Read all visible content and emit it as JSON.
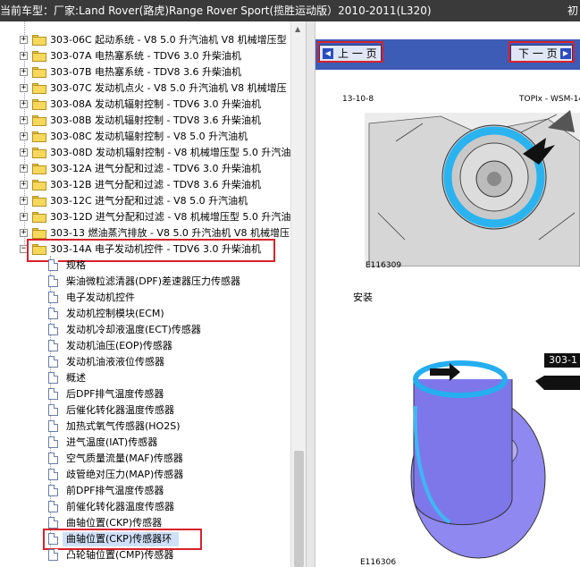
{
  "window": {
    "title": "当前车型：厂家:Land Rover(路虎)Range Rover Sport(揽胜运动版）2010-2011(L320)",
    "corner_text": "初"
  },
  "tree": {
    "folders": [
      {
        "label": "303-06C 起动系统 - V8 5.0 升汽油机 V8 机械增压型"
      },
      {
        "label": "303-07A 电热塞系统 - TDV6 3.0 升柴油机"
      },
      {
        "label": "303-07B 电热塞系统 - TDV8 3.6 升柴油机"
      },
      {
        "label": "303-07C 发动机点火 - V8 5.0 升汽油机 V8 机械增压"
      },
      {
        "label": "303-08A 发动机辐射控制 - TDV6 3.0 升柴油机"
      },
      {
        "label": "303-08B 发动机辐射控制 - TDV8 3.6 升柴油机"
      },
      {
        "label": "303-08C 发动机辐射控制 - V8 5.0 升汽油机"
      },
      {
        "label": "303-08D 发动机辐射控制 - V8 机械增压型 5.0 升汽油"
      },
      {
        "label": "303-12A 进气分配和过滤 - TDV6 3.0 升柴油机"
      },
      {
        "label": "303-12B 进气分配和过滤 - TDV8 3.6 升柴油机"
      },
      {
        "label": "303-12C 进气分配和过滤 - V8 5.0 升汽油机"
      },
      {
        "label": "303-12D 进气分配和过滤 - V8 机械增压型 5.0 升汽油"
      },
      {
        "label": "303-13 燃油蒸汽排放 - V8 5.0 升汽油机 V8 机械增压"
      },
      {
        "label": "303-14A 电子发动机控件 - TDV6 3.0 升柴油机"
      }
    ],
    "expander_plus": "+",
    "expander_minus": "−",
    "documents": [
      {
        "label": "规格"
      },
      {
        "label": "柴油微粒滤清器(DPF)差速器压力传感器"
      },
      {
        "label": "电子发动机控件"
      },
      {
        "label": "发动机控制模块(ECM)"
      },
      {
        "label": "发动机冷却液温度(ECT)传感器"
      },
      {
        "label": "发动机油压(EOP)传感器"
      },
      {
        "label": "发动机油液液位传感器"
      },
      {
        "label": "概述"
      },
      {
        "label": "后DPF排气温度传感器"
      },
      {
        "label": "后催化转化器温度传感器"
      },
      {
        "label": "加热式氧气传感器(HO2S)"
      },
      {
        "label": "进气温度(IAT)传感器"
      },
      {
        "label": "空气质量流量(MAF)传感器"
      },
      {
        "label": "歧管绝对压力(MAP)传感器"
      },
      {
        "label": "前DPF排气温度传感器"
      },
      {
        "label": "前催化转化器温度传感器"
      },
      {
        "label": "曲轴位置(CKP)传感器"
      },
      {
        "label": "曲轴位置(CKP)传感器环"
      },
      {
        "label": "凸轮轴位置(CMP)传感器"
      }
    ]
  },
  "nav": {
    "prev_label": "上 一 页",
    "next_label": "下 一 页"
  },
  "doc_page": {
    "header_left": "13-10-8",
    "header_right": "TOPIx - WSM-14",
    "figure1_id": "E116309",
    "section_heading": "安装",
    "callout": "303-1",
    "figure2_id": "E116306"
  },
  "colors": {
    "titlebar": "#3a3a3a",
    "nav_bar": "#3d5cb5",
    "highlight_box": "#d8222a",
    "part_blue": "#29b6f0",
    "ring_purple": "#8f88f0"
  }
}
